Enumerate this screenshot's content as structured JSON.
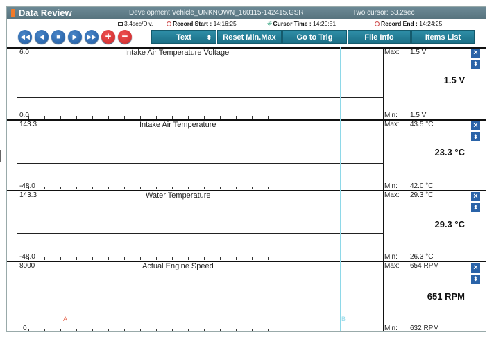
{
  "window": {
    "app_title": "Data Review",
    "file_name": "Development Vehicle_UNKNOWN_160115-142415.GSR",
    "cursor_mode": "Two cursor: 53.2sec"
  },
  "info": {
    "time_div": "3.4sec/Div.",
    "record_start_label": "Record Start :",
    "record_start": "14:16:25",
    "cursor_time_label": "Cursor Time :",
    "cursor_time": "14:20:51",
    "record_end_label": "Record End :",
    "record_end": "14:24:25"
  },
  "toolbar": {
    "text_select": "Text",
    "reset_minmax": "Reset Min.Max",
    "go_to_trig": "Go to Trig",
    "file_info": "File Info",
    "items_list": "Items List"
  },
  "labels": {
    "max": "Max:",
    "min": "Min:"
  },
  "channels": [
    {
      "title": "Intake Air Temperature Voltage",
      "y_max": "6.0",
      "y_min": "0.0",
      "max": "1.5 V",
      "min": "1.5 V",
      "current": "1.5 V"
    },
    {
      "title": "Intake Air Temperature",
      "y_max": "143.3",
      "y_min": "-48.0",
      "max": "43.5 °C",
      "min": "42.0 °C",
      "current": "23.3 °C"
    },
    {
      "title": "Water Temperature",
      "y_max": "143.3",
      "y_min": "-48.0",
      "max": "29.3 °C",
      "min": "26.3 °C",
      "current": "29.3 °C"
    },
    {
      "title": "Actual Engine Speed",
      "y_max": "8000",
      "y_min": "0",
      "max": "654 RPM",
      "min": "632 RPM",
      "current": "651 RPM"
    }
  ],
  "cursors": {
    "a": "A",
    "b": "B"
  },
  "colors": {
    "titlebar": "#5f7c87",
    "button": "#1f7c94",
    "nav_button": "#2a6db5",
    "cursor_a": "#e8705a",
    "cursor_b": "#8ed8e8"
  }
}
